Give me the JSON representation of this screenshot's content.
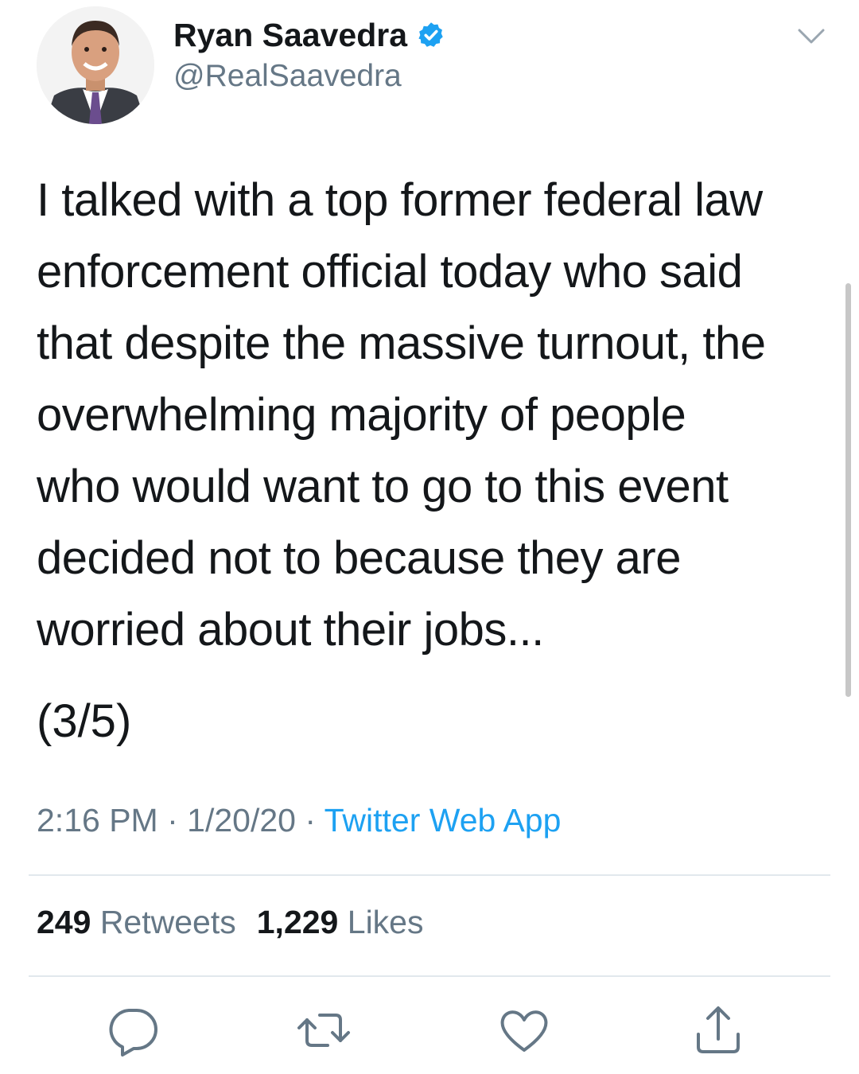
{
  "user": {
    "display_name": "Ryan Saavedra",
    "handle": "@RealSaavedra",
    "verified": true,
    "avatar_icon": "profile-photo"
  },
  "tweet": {
    "lines": [
      "I talked with a top former federal law",
      "enforcement official today who said",
      "that despite the massive turnout, the",
      "overwhelming majority of people",
      "who would want to go to this event",
      "decided not to because they are",
      "worried about their jobs..."
    ],
    "thread_count": "(3/5)"
  },
  "meta": {
    "time": "2:16 PM",
    "separator": " · ",
    "date": "1/20/20",
    "source": "Twitter Web App"
  },
  "stats": {
    "retweets_count": "249",
    "retweets_label": "Retweets",
    "likes_count": "1,229",
    "likes_label": "Likes"
  },
  "actions": [
    "reply-icon",
    "retweet-icon",
    "like-icon",
    "share-icon"
  ],
  "colors": {
    "text": "#14171a",
    "secondary": "#657786",
    "accent": "#1da1f2",
    "divider": "#e1e8ed"
  }
}
